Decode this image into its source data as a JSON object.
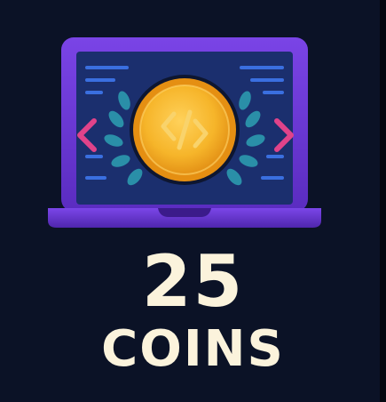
{
  "reward": {
    "amount": "25",
    "unit": "COINS"
  },
  "icons": {
    "laptop": "laptop-icon",
    "coin": "coin-icon",
    "laurel": "laurel-wreath-icon",
    "left_arrow": "chevron-left-icon",
    "right_arrow": "chevron-right-icon",
    "code_symbol": "code-bracket-icon"
  },
  "colors": {
    "background": "#0b1226",
    "laptop_frame": "#6a35d6",
    "screen": "#1b2f6e",
    "code_lines": "#3a6fe0",
    "laurel": "#2a8fa8",
    "coin_outer": "#f0a21a",
    "coin_inner": "#f6b52a",
    "chevron": "#e0438a",
    "text": "#fbf3dc"
  }
}
